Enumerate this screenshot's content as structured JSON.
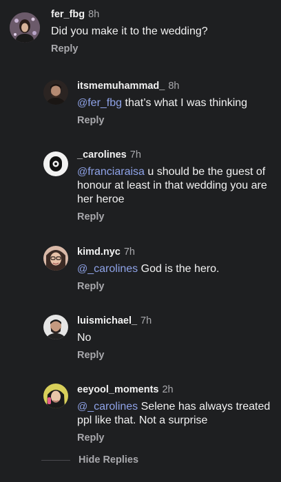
{
  "comments": [
    {
      "username": "fer_fbg",
      "time": "8h",
      "mention": "",
      "text": "Did you make it to the wedding?",
      "reply_label": "Reply"
    },
    {
      "username": "itsmemuhammad_",
      "time": "8h",
      "mention": "fer_fbg",
      "text": " that’s what I was thinking",
      "reply_label": "Reply"
    },
    {
      "username": "_carolines",
      "time": "7h",
      "mention": "franciaraisa",
      "text": " u should be the guest of honour at least in that wedding you are her heroe",
      "reply_label": "Reply"
    },
    {
      "username": "kimd.nyc",
      "time": "7h",
      "mention": "_carolines",
      "text": " God is the hero.",
      "reply_label": "Reply"
    },
    {
      "username": "luismichael_",
      "time": "7h",
      "mention": "",
      "text": "No",
      "reply_label": "Reply"
    },
    {
      "username": "eeyool_moments",
      "time": "2h",
      "mention": "_carolines",
      "text": " Selene has always treated ppl like that. Not a surprise",
      "reply_label": "Reply"
    }
  ],
  "hide_replies_label": "Hide Replies",
  "colors": {
    "background": "#1e1f21",
    "mention": "#8fa3e8",
    "secondary_text": "#a9a9ad"
  }
}
